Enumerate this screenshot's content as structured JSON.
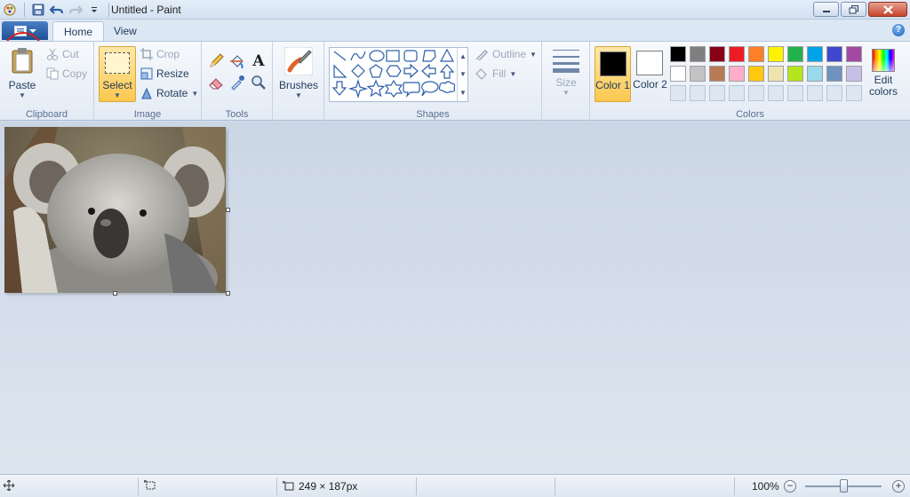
{
  "window": {
    "title": "Untitled - Paint",
    "controls": [
      "minimize-icon",
      "restore-icon",
      "close-icon"
    ]
  },
  "quick_access": {
    "icons": [
      "paint-app-icon",
      "save-icon",
      "undo-icon",
      "redo-icon",
      "customize-dropdown-icon"
    ]
  },
  "tabs": [
    {
      "label": "Home",
      "active": true
    },
    {
      "label": "View",
      "active": false
    }
  ],
  "ribbon": {
    "clipboard": {
      "group_label": "Clipboard",
      "paste": "Paste",
      "cut": "Cut",
      "copy": "Copy"
    },
    "image": {
      "group_label": "Image",
      "select": "Select",
      "crop": "Crop",
      "resize": "Resize",
      "rotate": "Rotate"
    },
    "tools": {
      "group_label": "Tools",
      "items": [
        "pencil-icon",
        "fill-bucket-icon",
        "text-icon",
        "eraser-icon",
        "color-picker-icon",
        "magnifier-icon"
      ]
    },
    "brushes": {
      "label": "Brushes"
    },
    "shapes": {
      "group_label": "Shapes",
      "outline": "Outline",
      "fill": "Fill"
    },
    "size": {
      "label": "Size"
    },
    "colors": {
      "group_label": "Colors",
      "color1_label": "Color 1",
      "color1_value": "#000000",
      "color2_label": "Color 2",
      "color2_value": "#ffffff",
      "edit_colors": "Edit colors",
      "palette_row1": [
        "#000000",
        "#7f7f7f",
        "#880015",
        "#ed1c24",
        "#ff7f27",
        "#fff200",
        "#22b14c",
        "#00a2e8",
        "#3f48cc",
        "#a349a4"
      ],
      "palette_row2": [
        "#ffffff",
        "#c3c3c3",
        "#b97a57",
        "#ffaec9",
        "#ffc90e",
        "#efe4b0",
        "#b5e61d",
        "#99d9ea",
        "#7092be",
        "#c8bfe7"
      ]
    }
  },
  "statusbar": {
    "selection_size": "249 × 187px",
    "zoom": "100%"
  }
}
